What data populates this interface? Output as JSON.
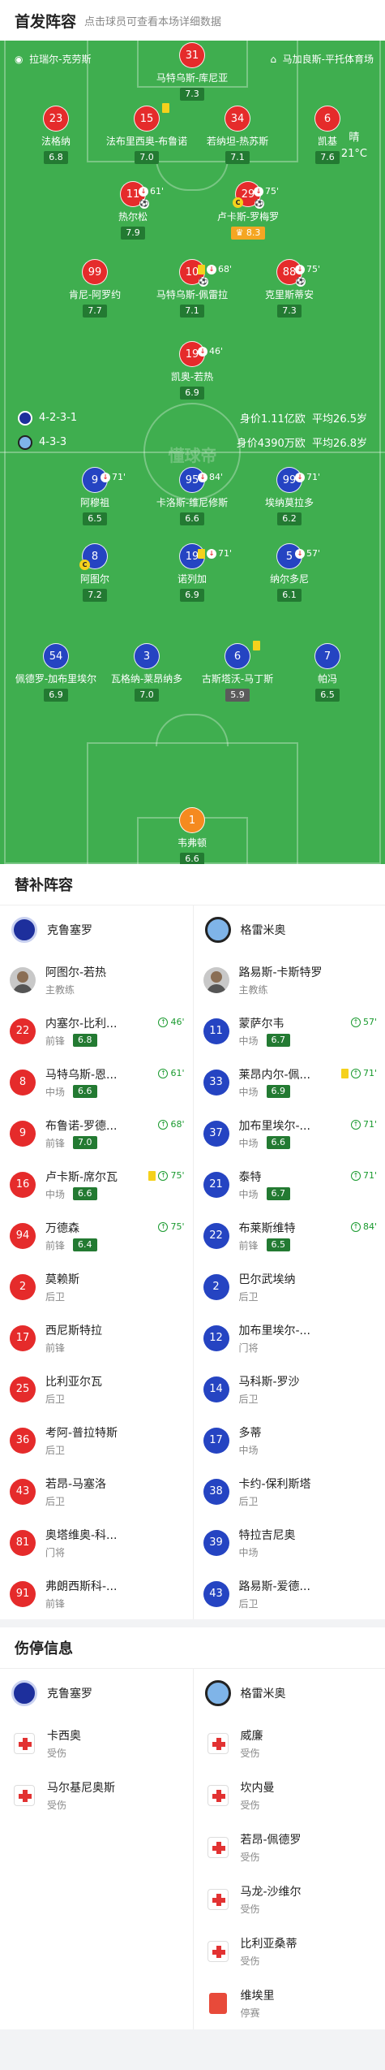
{
  "header": {
    "title": "首发阵容",
    "subtitle": "点击球员可查看本场详细数据"
  },
  "pitch": {
    "home_stadium": "拉瑞尔-克劳斯",
    "away_stadium": "马加良斯-平托体育场",
    "weather": "晴",
    "temperature": "21°C",
    "watermark": "懂球帝",
    "home_formation": "4-2-3-1",
    "home_value": "身价1.11亿欧",
    "home_age": "平均26.5岁",
    "away_formation": "4-3-3",
    "away_value": "身价4390万欧",
    "away_age": "平均26.8岁"
  },
  "home_players": [
    {
      "num": "31",
      "name": "马特乌斯-库尼亚",
      "rating": "7.3",
      "events": ""
    },
    {
      "num": "23",
      "name": "法格纳",
      "rating": "6.8",
      "events": ""
    },
    {
      "num": "15",
      "name": "法布里西奥-布鲁诺",
      "rating": "7.0",
      "events": ""
    },
    {
      "num": "34",
      "name": "若纳坦-热苏斯",
      "rating": "7.1",
      "events": ""
    },
    {
      "num": "6",
      "name": "凯基",
      "rating": "7.6",
      "events": ""
    },
    {
      "num": "11",
      "name": "热尔松",
      "rating": "7.9",
      "events": "61'"
    },
    {
      "num": "29",
      "name": "卢卡斯-罗梅罗",
      "rating": "8.3",
      "events": "75'"
    },
    {
      "num": "99",
      "name": "肯尼-阿罗约",
      "rating": "7.7",
      "events": ""
    },
    {
      "num": "10",
      "name": "马特乌斯-佩雷拉",
      "rating": "7.1",
      "events": "68'"
    },
    {
      "num": "88",
      "name": "克里斯蒂安",
      "rating": "7.3",
      "events": "75'"
    },
    {
      "num": "19",
      "name": "凯奥-若热",
      "rating": "6.9",
      "events": "46'"
    }
  ],
  "away_players": [
    {
      "num": "9",
      "name": "阿穆祖",
      "rating": "6.5",
      "events": "71'"
    },
    {
      "num": "95",
      "name": "卡洛斯-维尼修斯",
      "rating": "6.6",
      "events": "84'"
    },
    {
      "num": "99",
      "name": "埃纳莫拉多",
      "rating": "6.2",
      "events": "71'"
    },
    {
      "num": "8",
      "name": "阿图尔",
      "rating": "7.2",
      "events": ""
    },
    {
      "num": "19",
      "name": "诺列加",
      "rating": "6.9",
      "events": "71'"
    },
    {
      "num": "5",
      "name": "纳尔多尼",
      "rating": "6.1",
      "events": "57'"
    },
    {
      "num": "54",
      "name": "佩德罗-加布里埃尔",
      "rating": "6.9",
      "events": ""
    },
    {
      "num": "3",
      "name": "瓦格纳-莱昂纳多",
      "rating": "7.0",
      "events": ""
    },
    {
      "num": "6",
      "name": "古斯塔沃-马丁斯",
      "rating": "5.9",
      "events": ""
    },
    {
      "num": "7",
      "name": "帕冯",
      "rating": "6.5",
      "events": ""
    },
    {
      "num": "1",
      "name": "韦弗顿",
      "rating": "6.6",
      "events": ""
    }
  ],
  "subs": {
    "title": "替补阵容",
    "home_team": "克鲁塞罗",
    "away_team": "格雷米奥",
    "home_coach": {
      "name": "阿图尔-若热",
      "role": "主教练"
    },
    "away_coach": {
      "name": "路易斯-卡斯特罗",
      "role": "主教练"
    },
    "home": [
      {
        "num": "22",
        "name": "内塞尔-比利...",
        "pos": "前锋",
        "rating": "6.8",
        "time": "46'"
      },
      {
        "num": "8",
        "name": "马特乌斯-恩...",
        "pos": "中场",
        "rating": "6.6",
        "time": "61'"
      },
      {
        "num": "9",
        "name": "布鲁诺-罗德...",
        "pos": "前锋",
        "rating": "7.0",
        "time": "68'"
      },
      {
        "num": "16",
        "name": "卢卡斯-席尔瓦",
        "pos": "中场",
        "rating": "6.6",
        "time": "75'"
      },
      {
        "num": "94",
        "name": "万德森",
        "pos": "前锋",
        "rating": "6.4",
        "time": "75'"
      },
      {
        "num": "2",
        "name": "莫赖斯",
        "pos": "后卫",
        "rating": "",
        "time": ""
      },
      {
        "num": "17",
        "name": "西尼斯特拉",
        "pos": "前锋",
        "rating": "",
        "time": ""
      },
      {
        "num": "25",
        "name": "比利亚尔瓦",
        "pos": "后卫",
        "rating": "",
        "time": ""
      },
      {
        "num": "36",
        "name": "考阿-普拉特斯",
        "pos": "后卫",
        "rating": "",
        "time": ""
      },
      {
        "num": "43",
        "name": "若昂-马塞洛",
        "pos": "后卫",
        "rating": "",
        "time": ""
      },
      {
        "num": "81",
        "name": "奥塔维奥-科...",
        "pos": "门将",
        "rating": "",
        "time": ""
      },
      {
        "num": "91",
        "name": "弗朗西斯科-...",
        "pos": "前锋",
        "rating": "",
        "time": ""
      }
    ],
    "away": [
      {
        "num": "11",
        "name": "蒙萨尔韦",
        "pos": "中场",
        "rating": "6.7",
        "time": "57'"
      },
      {
        "num": "33",
        "name": "莱昂内尔-佩...",
        "pos": "中场",
        "rating": "6.9",
        "time": "71'"
      },
      {
        "num": "37",
        "name": "加布里埃尔-...",
        "pos": "中场",
        "rating": "6.6",
        "time": "71'"
      },
      {
        "num": "21",
        "name": "泰特",
        "pos": "中场",
        "rating": "6.7",
        "time": "71'"
      },
      {
        "num": "22",
        "name": "布莱斯维特",
        "pos": "前锋",
        "rating": "6.5",
        "time": "84'"
      },
      {
        "num": "2",
        "name": "巴尔武埃纳",
        "pos": "后卫",
        "rating": "",
        "time": ""
      },
      {
        "num": "12",
        "name": "加布里埃尔-...",
        "pos": "门将",
        "rating": "",
        "time": ""
      },
      {
        "num": "14",
        "name": "马科斯-罗沙",
        "pos": "后卫",
        "rating": "",
        "time": ""
      },
      {
        "num": "17",
        "name": "多蒂",
        "pos": "中场",
        "rating": "",
        "time": ""
      },
      {
        "num": "38",
        "name": "卡约-保利斯塔",
        "pos": "后卫",
        "rating": "",
        "time": ""
      },
      {
        "num": "39",
        "name": "特拉吉尼奥",
        "pos": "中场",
        "rating": "",
        "time": ""
      },
      {
        "num": "43",
        "name": "路易斯-爱德...",
        "pos": "后卫",
        "rating": "",
        "time": ""
      }
    ]
  },
  "injuries": {
    "title": "伤停信息",
    "home": [
      {
        "name": "卡西奥",
        "status": "受伤"
      },
      {
        "name": "马尔基尼奥斯",
        "status": "受伤"
      }
    ],
    "away": [
      {
        "name": "威廉",
        "status": "受伤"
      },
      {
        "name": "坎内曼",
        "status": "受伤"
      },
      {
        "name": "若昂-佩德罗",
        "status": "受伤"
      },
      {
        "name": "马龙-沙维尔",
        "status": "受伤"
      },
      {
        "name": "比利亚桑蒂",
        "status": "受伤"
      },
      {
        "name": "维埃里",
        "status": "停赛"
      }
    ]
  }
}
